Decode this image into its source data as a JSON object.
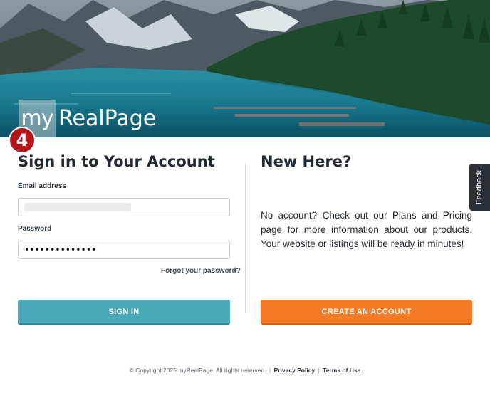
{
  "brand": {
    "logo_my": "my",
    "logo_rest": "RealPage"
  },
  "step_badge": "4",
  "signin": {
    "title": "Sign in to Your Account",
    "email_label": "Email address",
    "email_value": "",
    "password_label": "Password",
    "password_value": "••••••••••••••",
    "forgot_link": "Forgot your password?",
    "submit_label": "SIGN IN"
  },
  "new_here": {
    "title": "New Here?",
    "text": "No account? Check out our Plans and Pricing page for more information about our products. Your website or listings will be ready in minutes!",
    "create_label": "CREATE AN ACCOUNT"
  },
  "feedback_label": "Feedback",
  "footer": {
    "copyright": "© Copyright 2025 myRealPage. All rights reserved.",
    "separator": "|",
    "privacy": "Privacy Policy",
    "terms": "Terms of Use"
  },
  "colors": {
    "signin_button": "#48a9b8",
    "create_button": "#f47a25",
    "badge": "#b3161a",
    "feedback_tab": "#2b3138"
  },
  "icons": {
    "hero": "mountain-lake-photo"
  }
}
